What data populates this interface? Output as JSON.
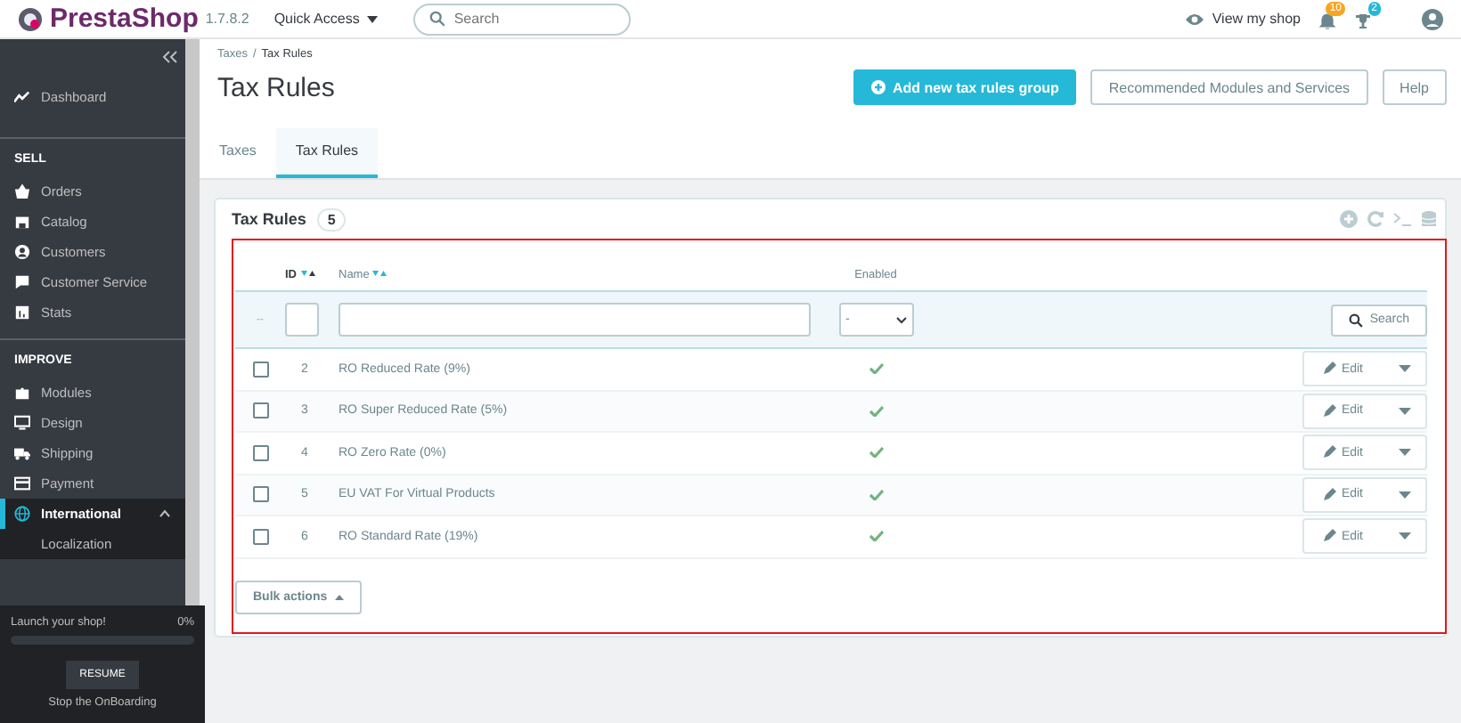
{
  "topbar": {
    "logo": "PrestaShop",
    "version": "1.7.8.2",
    "quick_access": "Quick Access",
    "search": {
      "placeholder": "Search"
    },
    "view_shop": "View my shop",
    "notifications": [
      {
        "kind": "bell",
        "count": "10"
      },
      {
        "kind": "trophy",
        "count": "2"
      }
    ]
  },
  "sidebar": {
    "groups": [
      {
        "items": [
          {
            "label": "Dashboard",
            "selected": false
          }
        ]
      },
      {
        "heading": "SELL",
        "items": [
          {
            "label": "Orders",
            "selected": false
          },
          {
            "label": "Catalog",
            "selected": false
          },
          {
            "label": "Customers",
            "selected": false
          },
          {
            "label": "Customer Service",
            "selected": false
          },
          {
            "label": "Stats",
            "selected": false
          }
        ]
      },
      {
        "heading": "IMPROVE",
        "items": [
          {
            "label": "Modules",
            "selected": false
          },
          {
            "label": "Design",
            "selected": false
          },
          {
            "label": "Shipping",
            "selected": false
          },
          {
            "label": "Payment",
            "selected": false
          },
          {
            "label": "International",
            "selected": true,
            "expanded": true,
            "children": [
              {
                "label": "Localization",
                "selected": false
              }
            ]
          }
        ]
      }
    ]
  },
  "onboarding": {
    "title": "Launch your shop!",
    "percent": "0%",
    "resume": "RESUME",
    "stop": "Stop the OnBoarding"
  },
  "header": {
    "breadcrumb": [
      "Taxes",
      "Tax Rules"
    ],
    "breadcrumb_separator": "/",
    "title": "Tax Rules",
    "buttons": [
      {
        "label": "Add new tax rules group",
        "kind": "primary"
      },
      {
        "label": "Recommended Modules and Services",
        "kind": "default"
      },
      {
        "label": "Help",
        "kind": "default"
      }
    ],
    "tabs": [
      {
        "label": "Taxes",
        "selected": false
      },
      {
        "label": "Tax Rules",
        "selected": true
      }
    ]
  },
  "panel": {
    "title": "Tax Rules",
    "count": "5",
    "columns": [
      {
        "label": "ID"
      },
      {
        "label": "Name"
      },
      {
        "label": "Enabled"
      }
    ],
    "filter": {
      "reset": "--",
      "enabled_value": "-",
      "search": "Search"
    },
    "rows": [
      {
        "checked": false,
        "id": "2",
        "name": "RO Reduced Rate (9%)",
        "enabled": true,
        "action": "Edit"
      },
      {
        "checked": false,
        "id": "3",
        "name": "RO Super Reduced Rate (5%)",
        "enabled": true,
        "action": "Edit"
      },
      {
        "checked": false,
        "id": "4",
        "name": "RO Zero Rate (0%)",
        "enabled": true,
        "action": "Edit"
      },
      {
        "checked": false,
        "id": "5",
        "name": "EU VAT For Virtual Products",
        "enabled": true,
        "action": "Edit"
      },
      {
        "checked": false,
        "id": "6",
        "name": "RO Standard Rate (19%)",
        "enabled": true,
        "action": "Edit"
      }
    ],
    "bulk_actions": "Bulk actions"
  }
}
